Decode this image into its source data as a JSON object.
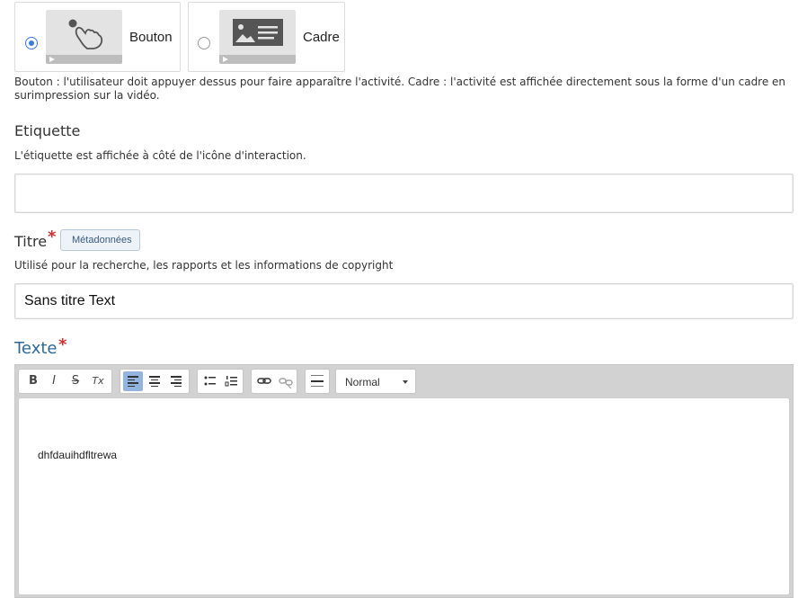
{
  "display_type": {
    "options": [
      {
        "label": "Bouton",
        "selected": true,
        "icon": "hand-pointer-icon"
      },
      {
        "label": "Cadre",
        "selected": false,
        "icon": "image-text-icon"
      }
    ],
    "description": "Bouton : l'utilisateur doit appuyer dessus pour faire apparaître l'activité. Cadre : l'activité est affichée directement sous la forme d'un cadre en surimpression sur la vidéo."
  },
  "label_field": {
    "title": "Etiquette",
    "description": "L'étiquette est affichée à côté de l'icône d'interaction.",
    "value": ""
  },
  "title_field": {
    "title": "Titre",
    "required_mark": "*",
    "metadata_tag": "Métadonnées",
    "description": "Utilisé pour la recherche, les rapports et les informations de copyright",
    "value": "Sans titre Text"
  },
  "text_field": {
    "title": "Texte",
    "required_mark": "*",
    "title_color": "#2d6a99",
    "toolbar": {
      "bold": "B",
      "italic": "I",
      "strike": "S",
      "clear": "Tx",
      "format_select": "Normal"
    },
    "content": "dhfdauihdfltrewa"
  },
  "colors": {
    "accent_blue": "#3a7be0",
    "required_red": "#d0302f",
    "active_button": "#92b4df"
  }
}
